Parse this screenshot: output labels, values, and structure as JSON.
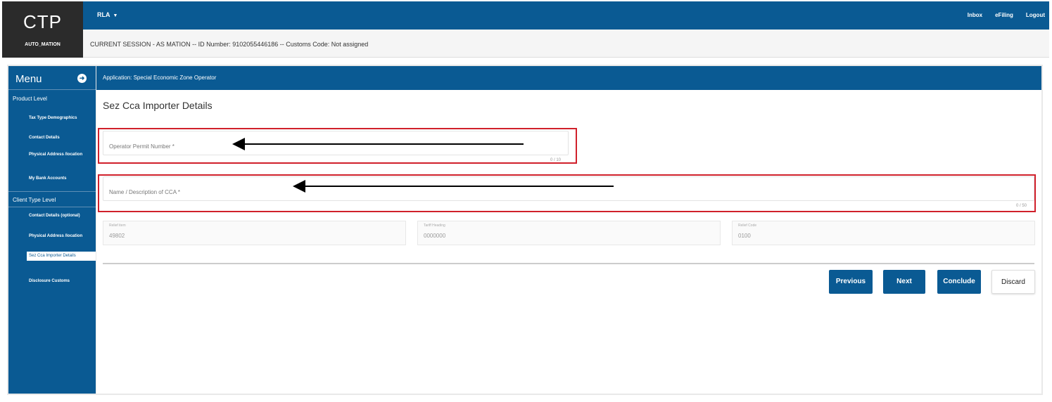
{
  "brand": {
    "title": "CTP",
    "subtitle": "AUTO_MATION"
  },
  "header": {
    "user_menu": "RLA",
    "links": [
      "Inbox",
      "eFiling",
      "Logout"
    ],
    "session": "CURRENT SESSION - AS MATION -- ID Number: 9102055446186 -- Customs Code: Not assigned"
  },
  "sidebar": {
    "title": "Menu",
    "product_level": "Product Level",
    "product_items": [
      "Tax Type Demographics",
      "Contact Details",
      "Physical Address /location",
      "My Bank Accounts"
    ],
    "client_level": "Client Type Level",
    "client_items": [
      "Contact Details (optional)",
      "Physical Address /location",
      "Sez Cca Importer Details",
      "Disclosure Customs"
    ],
    "active_item": "Sez Cca Importer Details"
  },
  "main": {
    "application_title": "Application: Special Economic Zone Operator",
    "page_title": "Sez Cca Importer Details",
    "fields": {
      "operator_permit": {
        "placeholder": "Operator Permit Number *",
        "counter": "0 / 10"
      },
      "cca_name": {
        "placeholder": "Name / Description of CCA *",
        "counter": "0 / 50"
      }
    },
    "readonly": [
      {
        "label": "Relief item",
        "value": "49802"
      },
      {
        "label": "Tariff Heading",
        "value": "0000000"
      },
      {
        "label": "Relief Code",
        "value": "0100"
      }
    ],
    "buttons": {
      "previous": "Previous",
      "next": "Next",
      "conclude": "Conclude",
      "discard": "Discard"
    }
  },
  "colors": {
    "brand_blue": "#0a5a93",
    "logo_bg": "#2b2b2b",
    "annotation_red": "#d0202b",
    "annotation_arrow": "#000000"
  },
  "icons": {
    "menu_toggle": "arrow-circle-right-icon",
    "user_menu_caret": "caret-down-icon"
  }
}
